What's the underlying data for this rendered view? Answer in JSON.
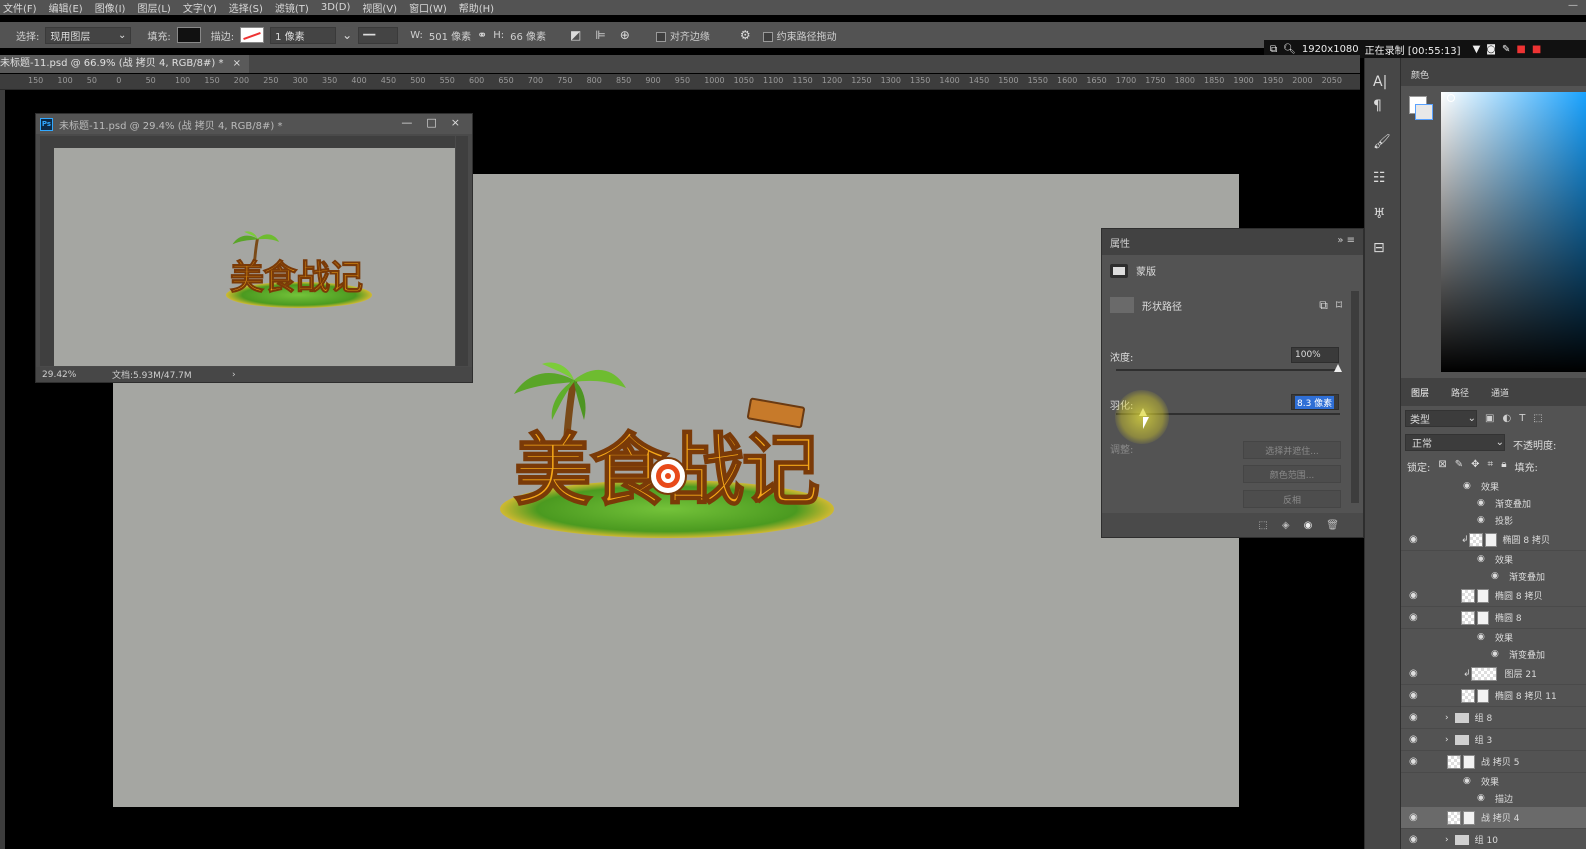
{
  "menu": {
    "items": [
      "文件(F)",
      "编辑(E)",
      "图像(I)",
      "图层(L)",
      "文字(Y)",
      "选择(S)",
      "滤镜(T)",
      "3D(D)",
      "视图(V)",
      "窗口(W)",
      "帮助(H)"
    ],
    "minimize": "—"
  },
  "options": {
    "select_label": "选择:",
    "select_value": "现用图层",
    "fill_label": "填充:",
    "stroke_label": "描边:",
    "stroke_width": "1 像素",
    "w_label": "W:",
    "w_value": "501 像素",
    "h_label": "H:",
    "h_value": "66 像素",
    "align_edges": "对齐边缘",
    "constrain_path": "约束路径拖动"
  },
  "recording": {
    "resolution": "1920x1080",
    "status": "正在录制 [00:55:13]"
  },
  "document": {
    "tab_title": "未标题-11.psd @ 66.9% (战 拷贝 4, RGB/8#) *",
    "close": "×",
    "ruler_ticks": [
      "150",
      "100",
      "50",
      "0",
      "50",
      "100",
      "150",
      "200",
      "250",
      "300",
      "350",
      "400",
      "450",
      "500",
      "550",
      "600",
      "650",
      "700",
      "750",
      "800",
      "850",
      "900",
      "950",
      "1000",
      "1050",
      "1100",
      "1150",
      "1200",
      "1250",
      "1300",
      "1350",
      "1400",
      "1450",
      "1500",
      "1550",
      "1600",
      "1650",
      "1700",
      "1750",
      "1800",
      "1850",
      "1900",
      "1950",
      "2000",
      "2050"
    ]
  },
  "logo": {
    "title": "美食战记"
  },
  "mini_window": {
    "title": "未标题-11.psd @ 29.4% (战 拷贝 4, RGB/8#) *",
    "zoom": "29.42%",
    "doc_size": "文档:5.93M/47.7M",
    "arrow": "›",
    "min": "—",
    "max": "□",
    "close": "×"
  },
  "properties": {
    "tab": "属性",
    "mask_label": "蒙版",
    "vector_mask": "形状路径",
    "density_label": "浓度:",
    "density_value": "100%",
    "feather_label": "羽化:",
    "feather_value": "8.3 像素",
    "refine_label": "调整:",
    "select_and_mask": "选择并遮住...",
    "color_range": "颜色范围...",
    "invert": "反相"
  },
  "color_panel": {
    "tab": "颜色"
  },
  "layers": {
    "tabs": [
      "图层",
      "路径",
      "通道"
    ],
    "filter": "类型",
    "blend_mode": "正常",
    "opacity_label": "不透明度:",
    "lock_label": "锁定:",
    "fill_label": "填充:",
    "rows": [
      {
        "label": "效果",
        "kind": "fx-head"
      },
      {
        "label": "渐变叠加",
        "kind": "fx"
      },
      {
        "label": "投影",
        "kind": "fx"
      },
      {
        "label": "椭圆 8 拷贝",
        "kind": "layer"
      },
      {
        "label": "效果",
        "kind": "fx-head"
      },
      {
        "label": "渐变叠加",
        "kind": "fx"
      },
      {
        "label": "椭圆 8 拷贝",
        "kind": "layer"
      },
      {
        "label": "椭圆 8",
        "kind": "layer"
      },
      {
        "label": "效果",
        "kind": "fx-head"
      },
      {
        "label": "渐变叠加",
        "kind": "fx"
      },
      {
        "label": "图层 21",
        "kind": "layer"
      },
      {
        "label": "椭圆 8 拷贝 11",
        "kind": "layer"
      },
      {
        "label": "组 8",
        "kind": "group"
      },
      {
        "label": "组 3",
        "kind": "group"
      },
      {
        "label": "战 拷贝 5",
        "kind": "layer"
      },
      {
        "label": "效果",
        "kind": "fx-head"
      },
      {
        "label": "描边",
        "kind": "fx"
      },
      {
        "label": "战 拷贝 4",
        "kind": "layer-selected"
      },
      {
        "label": "组 10",
        "kind": "group"
      }
    ]
  }
}
